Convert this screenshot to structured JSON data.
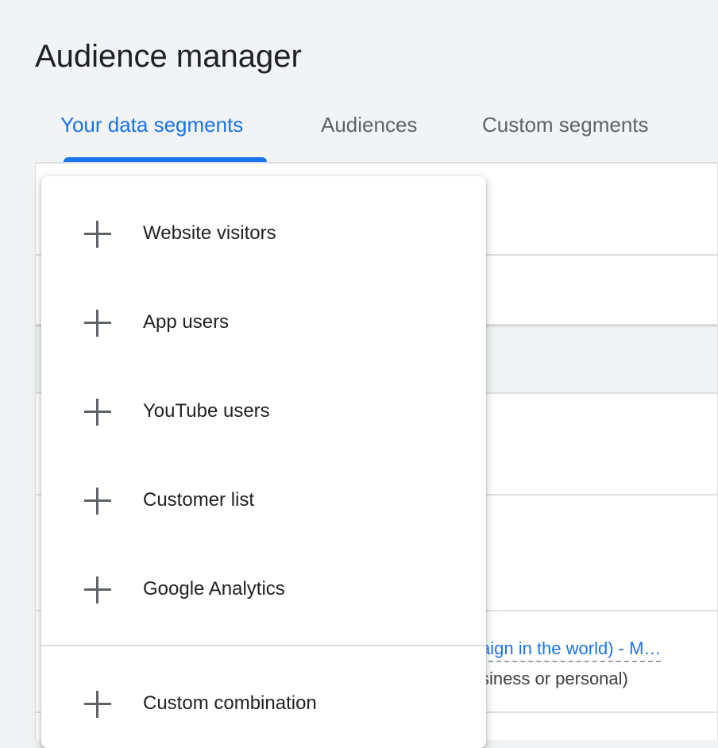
{
  "page": {
    "title": "Audience manager"
  },
  "tabs": [
    {
      "label": "Your data segments",
      "active": true
    },
    {
      "label": "Audiences",
      "active": false
    },
    {
      "label": "Custom segments",
      "active": false
    }
  ],
  "menu": {
    "items": [
      {
        "label": "Website visitors",
        "icon": "plus-icon"
      },
      {
        "label": "App users",
        "icon": "plus-icon"
      },
      {
        "label": "YouTube users",
        "icon": "plus-icon"
      },
      {
        "label": "Customer list",
        "icon": "plus-icon"
      },
      {
        "label": "Google Analytics",
        "icon": "plus-icon"
      },
      {
        "label": "Custom combination",
        "icon": "plus-icon"
      }
    ]
  },
  "background_table": {
    "partial_link": "aign in the world) - M…",
    "partial_subtext": "siness or personal)"
  },
  "colors": {
    "accent": "#1a73e8",
    "page_bg": "#f1f3f4",
    "text_primary": "#202124",
    "text_secondary": "#5f6368"
  }
}
